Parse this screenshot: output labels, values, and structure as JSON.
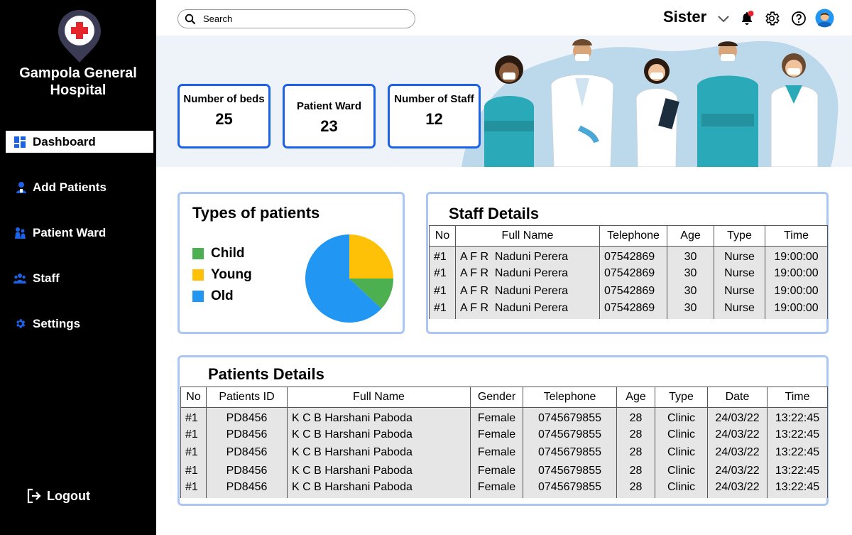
{
  "sidebar": {
    "hospital_name": "Gampola General Hospital",
    "hospital_name_line1": "Gampola General",
    "hospital_name_line2": "Hospital",
    "items": [
      {
        "label": "Dashboard",
        "icon": "dashboard-icon",
        "active": true
      },
      {
        "label": "Add Patients",
        "icon": "add-patient-icon",
        "active": false
      },
      {
        "label": "Patient Ward",
        "icon": "patient-ward-icon",
        "active": false
      },
      {
        "label": "Staff",
        "icon": "staff-icon",
        "active": false
      },
      {
        "label": "Settings",
        "icon": "gear-icon",
        "active": false
      }
    ],
    "logout_label": "Logout"
  },
  "topbar": {
    "search_placeholder": "Search",
    "user_role": "Sister",
    "icons": [
      "chevron-down-icon",
      "notification-bell-icon",
      "settings-gear-icon",
      "help-icon",
      "avatar"
    ]
  },
  "stats": [
    {
      "label": "Number of beds",
      "value": "25"
    },
    {
      "label": "Patient Ward",
      "value": "23"
    },
    {
      "label": "Number of Staff",
      "value": "12"
    }
  ],
  "colors": {
    "accent": "#1c62e6",
    "panel_border": "#a9c6f5",
    "child": "#4caf50",
    "young": "#ffc107",
    "old": "#2196f3"
  },
  "patient_types": {
    "title": "Types of patients",
    "legend": [
      "Child",
      "Young",
      "Old"
    ]
  },
  "chart_data": {
    "type": "pie",
    "title": "Types of patients",
    "categories": [
      "Young",
      "Child",
      "Old"
    ],
    "values": [
      25,
      12,
      63
    ]
  },
  "staff": {
    "title": "Staff Details",
    "columns": [
      "No",
      "Full Name",
      "Telephone",
      "Age",
      "Type",
      "Time"
    ],
    "rows": [
      [
        "#1",
        "A F R  Naduni Perera",
        "07542869",
        "30",
        "Nurse",
        "19:00:00"
      ],
      [
        "#1",
        "A F R  Naduni Perera",
        "07542869",
        "30",
        "Nurse",
        "19:00:00"
      ],
      [
        "#1",
        "A F R  Naduni Perera",
        "07542869",
        "30",
        "Nurse",
        "19:00:00"
      ],
      [
        "#1",
        "A F R  Naduni Perera",
        "07542869",
        "30",
        "Nurse",
        "19:00:00"
      ]
    ]
  },
  "patients": {
    "title": "Patients Details",
    "columns": [
      "No",
      "Patients ID",
      "Full Name",
      "Gender",
      "Telephone",
      "Age",
      "Type",
      "Date",
      "Time"
    ],
    "rows": [
      [
        "#1",
        "PD8456",
        "K C B Harshani Paboda",
        "Female",
        "0745679855",
        "28",
        "Clinic",
        "24/03/22",
        "13:22:45"
      ],
      [
        "#1",
        "PD8456",
        "K C B Harshani Paboda",
        "Female",
        "0745679855",
        "28",
        "Clinic",
        "24/03/22",
        "13:22:45"
      ],
      [
        "#1",
        "PD8456",
        "K C B Harshani Paboda",
        "Female",
        "0745679855",
        "28",
        "Clinic",
        "24/03/22",
        "13:22:45"
      ],
      [
        "#1",
        "PD8456",
        "K C B Harshani Paboda",
        "Female",
        "0745679855",
        "28",
        "Clinic",
        "24/03/22",
        "13:22:45"
      ],
      [
        "#1",
        "PD8456",
        "K C B Harshani Paboda",
        "Female",
        "0745679855",
        "28",
        "Clinic",
        "24/03/22",
        "13:22:45"
      ]
    ]
  }
}
